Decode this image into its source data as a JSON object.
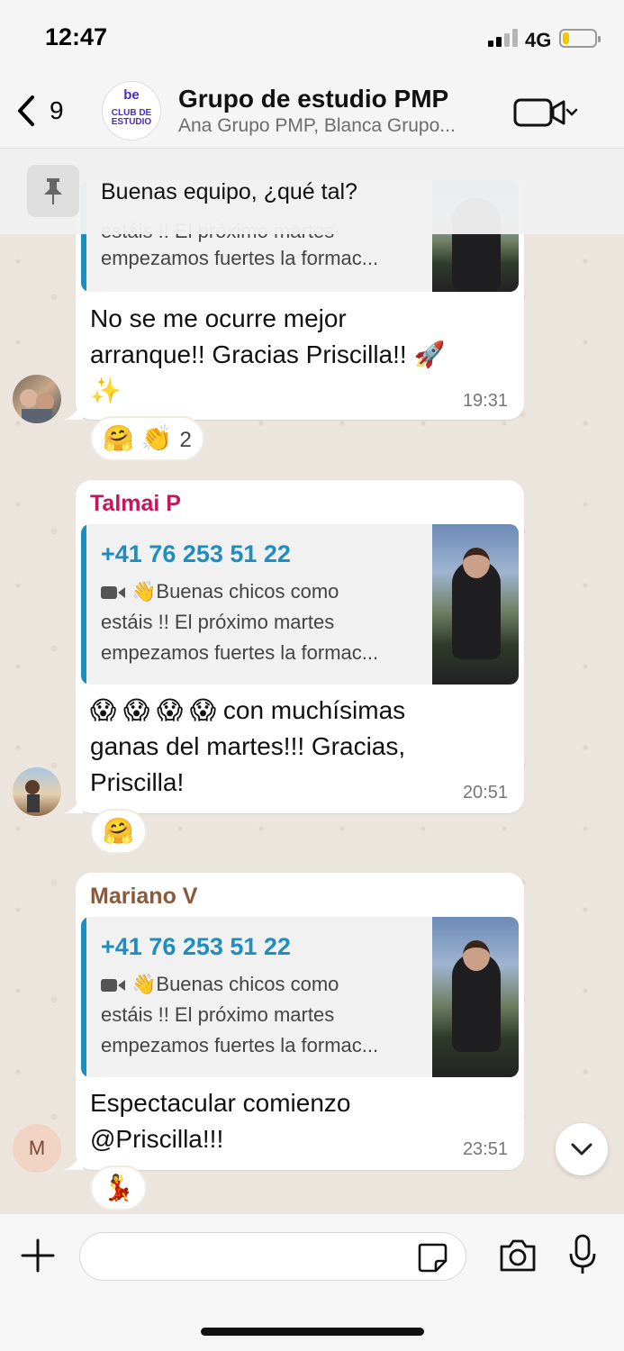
{
  "status_bar": {
    "time": "12:47",
    "network": "4G",
    "battery_level": 0.2
  },
  "header": {
    "back_count": "9",
    "group_avatar_top": "be",
    "group_avatar_text": "CLUB DE ESTUDIO",
    "title": "Grupo de estudio PMP",
    "subtitle": "Ana Grupo PMP, Blanca Grupo..."
  },
  "pinned": {
    "text": "Buenas equipo, ¿qué tal?"
  },
  "messages": [
    {
      "quote_lines": [
        "estáis !! El próximo martes",
        "empezamos fuertes la formac..."
      ],
      "text_lines": [
        "No se me ocurre mejor",
        "arranque!! Gracias Priscilla!! 🚀",
        "✨"
      ],
      "time": "19:31",
      "reactions": "🤗 👏",
      "reaction_count": "2"
    },
    {
      "sender": "Talmai P",
      "sender_color": "#c2185b",
      "quote_phone": "+41 76 253 51 22",
      "quote_lines": [
        "👋Buenas chicos como",
        "estáis !! El próximo martes",
        "empezamos fuertes la formac..."
      ],
      "text_lines": [
        "😱 😱 😱 😱  con muchísimas",
        "ganas del martes!!! Gracias,",
        "Priscilla!"
      ],
      "time": "20:51",
      "reactions": "🤗"
    },
    {
      "sender": "Mariano V",
      "sender_color": "#8a5a3c",
      "sender_initial": "M",
      "quote_phone": "+41 76 253 51 22",
      "quote_lines": [
        "👋Buenas chicos como",
        "estáis !! El próximo martes",
        "empezamos fuertes la formac..."
      ],
      "text_lines": [
        "Espectacular comienzo",
        "@Priscilla!!!"
      ],
      "time": "23:51",
      "reactions": "💃"
    }
  ],
  "composer": {
    "placeholder": ""
  },
  "icons": {
    "back": "chevron-left-icon",
    "video": "video-call-icon",
    "pin": "pin-icon",
    "plus": "plus-icon",
    "sticker": "sticker-icon",
    "camera": "camera-icon",
    "mic": "microphone-icon",
    "scroll": "chevron-down-icon"
  }
}
